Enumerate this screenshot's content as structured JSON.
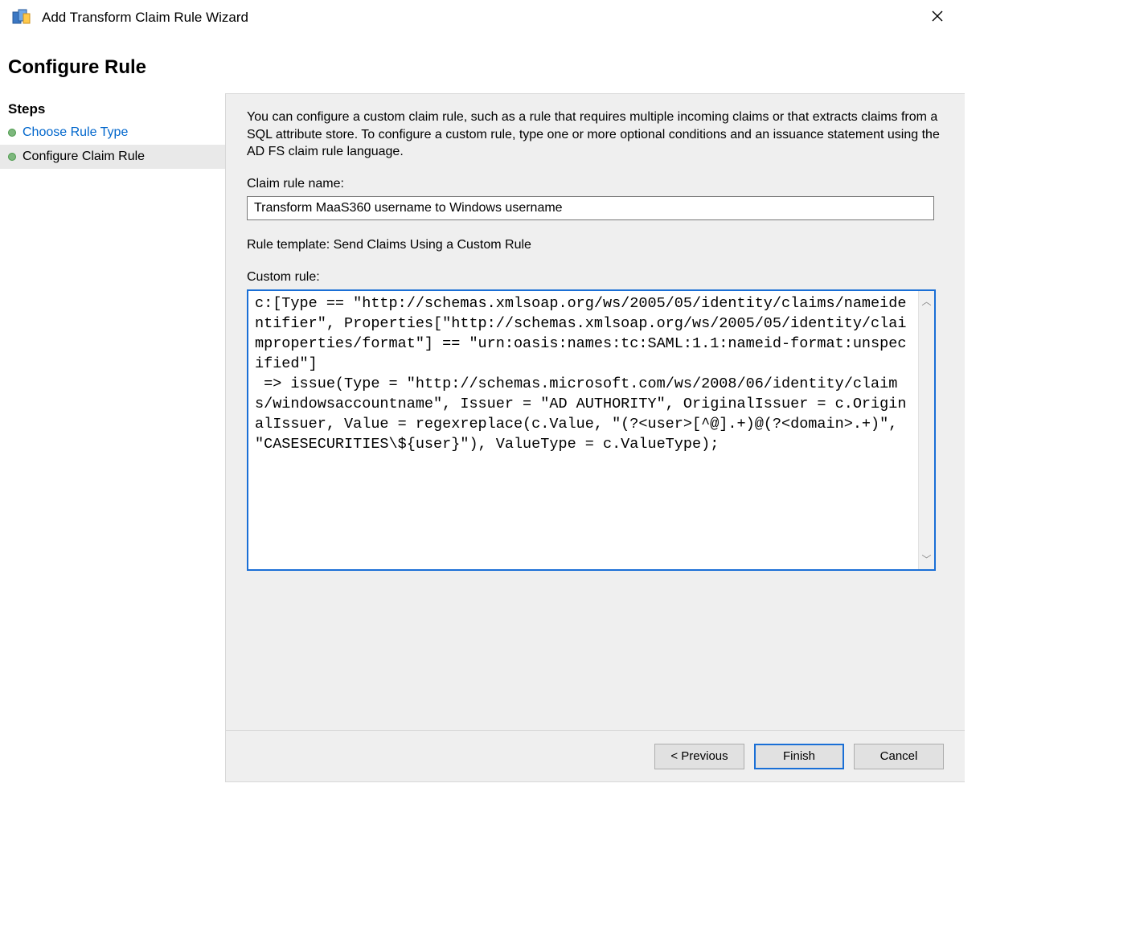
{
  "window": {
    "title": "Add Transform Claim Rule Wizard"
  },
  "header": {
    "page_title": "Configure Rule"
  },
  "sidebar": {
    "heading": "Steps",
    "items": [
      {
        "label": "Choose Rule Type",
        "state": "link"
      },
      {
        "label": "Configure Claim Rule",
        "state": "current"
      }
    ]
  },
  "main": {
    "description": "You can configure a custom claim rule, such as a rule that requires multiple incoming claims or that extracts claims from a SQL attribute store. To configure a custom rule, type one or more optional conditions and an issuance statement using the AD FS claim rule language.",
    "claim_rule_name_label": "Claim rule name:",
    "claim_rule_name_value": "Transform MaaS360 username to Windows username",
    "rule_template_label": "Rule template: Send Claims Using a Custom Rule",
    "custom_rule_label": "Custom rule:",
    "custom_rule_value": "c:[Type == \"http://schemas.xmlsoap.org/ws/2005/05/identity/claims/nameidentifier\", Properties[\"http://schemas.xmlsoap.org/ws/2005/05/identity/claimproperties/format\"] == \"urn:oasis:names:tc:SAML:1.1:nameid-format:unspecified\"]\n => issue(Type = \"http://schemas.microsoft.com/ws/2008/06/identity/claims/windowsaccountname\", Issuer = \"AD AUTHORITY\", OriginalIssuer = c.OriginalIssuer, Value = regexreplace(c.Value, \"(?<user>[^@].+)@(?<domain>.+)\", \"CASESECURITIES\\${user}\"), ValueType = c.ValueType);"
  },
  "buttons": {
    "previous": "< Previous",
    "finish": "Finish",
    "cancel": "Cancel"
  }
}
